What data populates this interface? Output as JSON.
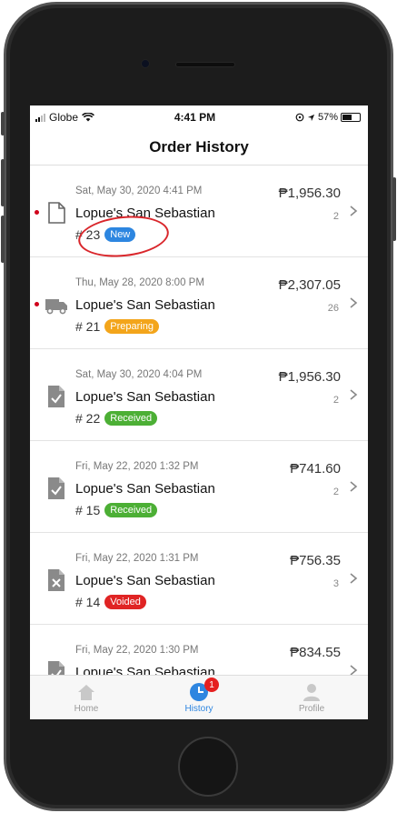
{
  "status_bar": {
    "carrier": "Globe",
    "time": "4:41 PM",
    "battery": "57%"
  },
  "header": {
    "title": "Order History"
  },
  "orders": [
    {
      "date": "Sat, May 30, 2020 4:41 PM",
      "store": "Lopue's San Sebastian",
      "number": "# 23",
      "status": "New",
      "status_color": "#2d86e0",
      "price": "₱1,956.30",
      "qty": "2",
      "icon": "document-icon",
      "unread": true
    },
    {
      "date": "Thu, May 28, 2020 8:00 PM",
      "store": "Lopue's San Sebastian",
      "number": "# 21",
      "status": "Preparing",
      "status_color": "#f3a51b",
      "price": "₱2,307.05",
      "qty": "26",
      "icon": "delivery-truck-icon",
      "unread": true
    },
    {
      "date": "Sat, May 30, 2020 4:04 PM",
      "store": "Lopue's San Sebastian",
      "number": "# 22",
      "status": "Received",
      "status_color": "#4caf35",
      "price": "₱1,956.30",
      "qty": "2",
      "icon": "document-check-icon",
      "unread": false
    },
    {
      "date": "Fri, May 22, 2020 1:32 PM",
      "store": "Lopue's San Sebastian",
      "number": "# 15",
      "status": "Received",
      "status_color": "#4caf35",
      "price": "₱741.60",
      "qty": "2",
      "icon": "document-check-icon",
      "unread": false
    },
    {
      "date": "Fri, May 22, 2020 1:31 PM",
      "store": "Lopue's San Sebastian",
      "number": "# 14",
      "status": "Voided",
      "status_color": "#e02424",
      "price": "₱756.35",
      "qty": "3",
      "icon": "document-x-icon",
      "unread": false
    },
    {
      "date": "Fri, May 22, 2020 1:30 PM",
      "store": "Lopue's San Sebastian",
      "number": "",
      "status": "",
      "status_color": "#4caf35",
      "price": "₱834.55",
      "qty": "",
      "icon": "document-check-icon",
      "unread": false
    }
  ],
  "watermark": "Lopue's",
  "tabs": [
    {
      "label": "Home",
      "icon": "home-icon",
      "active": false
    },
    {
      "label": "History",
      "icon": "clock-icon",
      "active": true,
      "badge": "1"
    },
    {
      "label": "Profile",
      "icon": "person-icon",
      "active": false
    }
  ],
  "colors": {
    "accent": "#2f86e0",
    "annotation": "#d9262b"
  }
}
